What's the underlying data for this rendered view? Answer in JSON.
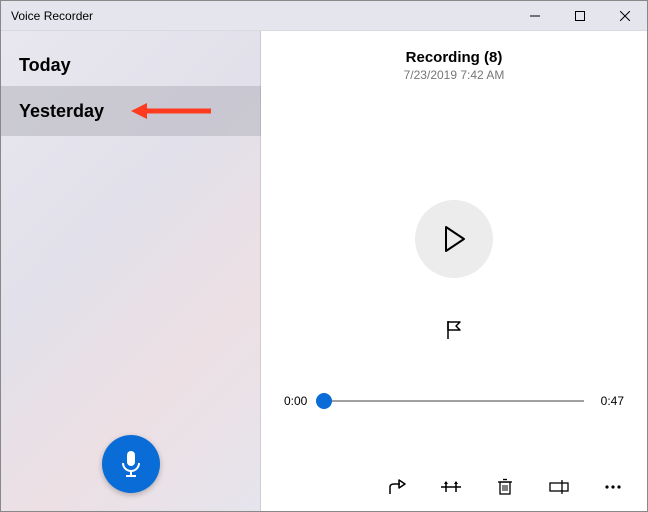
{
  "window": {
    "title": "Voice Recorder"
  },
  "sidebar": {
    "groups": [
      {
        "label": "Today"
      }
    ],
    "items": [
      {
        "label": "Yesterday",
        "selected": true
      }
    ]
  },
  "recording": {
    "title": "Recording (8)",
    "timestamp": "7/23/2019 7:42 AM",
    "current_time": "0:00",
    "total_time": "0:47"
  },
  "icons": {
    "minimize": "window-minimize",
    "maximize": "window-maximize",
    "close": "window-close",
    "mic": "microphone-icon",
    "play": "play-icon",
    "flag": "flag-icon",
    "share": "share-icon",
    "trim": "trim-icon",
    "delete": "trash-icon",
    "rename": "rename-icon",
    "more": "more-icon"
  }
}
